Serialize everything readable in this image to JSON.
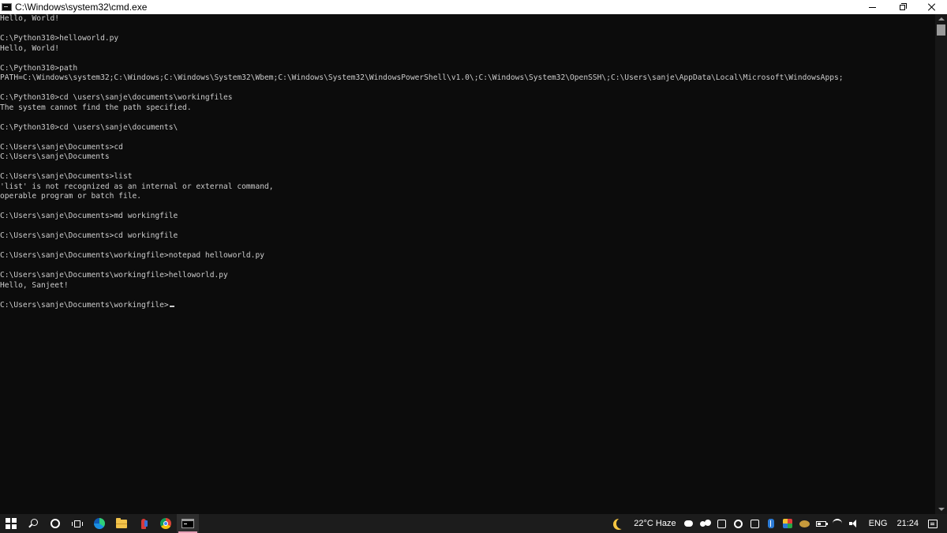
{
  "window": {
    "title": "C:\\Windows\\system32\\cmd.exe"
  },
  "console": {
    "lines": [
      "Hello, World!",
      "",
      "C:\\Python310>helloworld.py",
      "Hello, World!",
      "",
      "C:\\Python310>path",
      "PATH=C:\\Windows\\system32;C:\\Windows;C:\\Windows\\System32\\Wbem;C:\\Windows\\System32\\WindowsPowerShell\\v1.0\\;C:\\Windows\\System32\\OpenSSH\\;C:\\Users\\sanje\\AppData\\Local\\Microsoft\\WindowsApps;",
      "",
      "C:\\Python310>cd \\users\\sanje\\documents\\workingfiles",
      "The system cannot find the path specified.",
      "",
      "C:\\Python310>cd \\users\\sanje\\documents\\",
      "",
      "C:\\Users\\sanje\\Documents>cd",
      "C:\\Users\\sanje\\Documents",
      "",
      "C:\\Users\\sanje\\Documents>list",
      "'list' is not recognized as an internal or external command,",
      "operable program or batch file.",
      "",
      "C:\\Users\\sanje\\Documents>md workingfile",
      "",
      "C:\\Users\\sanje\\Documents>cd workingfile",
      "",
      "C:\\Users\\sanje\\Documents\\workingfile>notepad helloworld.py",
      "",
      "C:\\Users\\sanje\\Documents\\workingfile>helloworld.py",
      "Hello, Sanjeet!",
      ""
    ],
    "prompt": "C:\\Users\\sanje\\Documents\\workingfile>"
  },
  "taskbar": {
    "pinned_icons": [
      "windows-start-icon",
      "search-icon",
      "cortana-icon",
      "task-view-icon",
      "edge-icon",
      "file-explorer-icon",
      "app-icon",
      "chrome-icon",
      "command-prompt-icon"
    ],
    "active_app": "command-prompt-icon",
    "weather": "22°C  Haze",
    "language": "ENG",
    "clock": "21:24"
  },
  "colors": {
    "console_background": "#0c0c0c",
    "console_text": "#cccccc",
    "taskbar_background": "#1c1c1c",
    "active_indicator": "#e8a0b8"
  }
}
